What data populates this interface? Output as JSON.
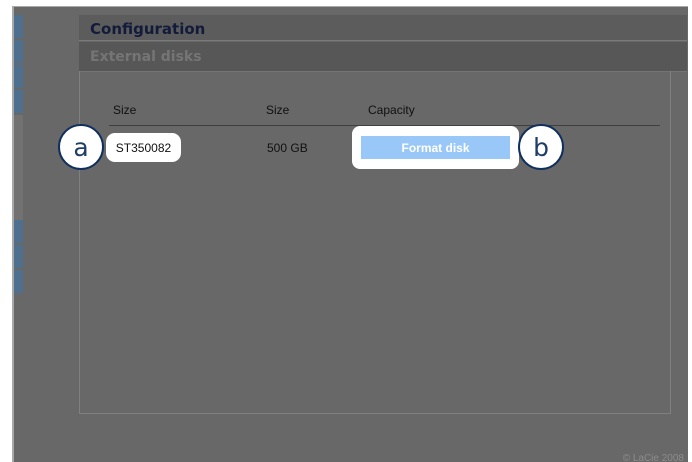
{
  "header": {
    "title": "Configuration"
  },
  "section": {
    "title": "External disks"
  },
  "table": {
    "headers": [
      "Size",
      "Size",
      "Capacity"
    ],
    "rows": [
      {
        "name": "ST350082",
        "size": "500 GB",
        "action_label": "Format disk"
      }
    ]
  },
  "callouts": {
    "a": "a",
    "b": "b"
  },
  "footer": {
    "text": "© LaCie 2008"
  },
  "colors": {
    "frame": "#686868",
    "sidebar_blue": "#4f6f8f",
    "header_text": "#131b3a",
    "button_blue": "#99c8f8",
    "callout_border": "#0f2f5d"
  }
}
